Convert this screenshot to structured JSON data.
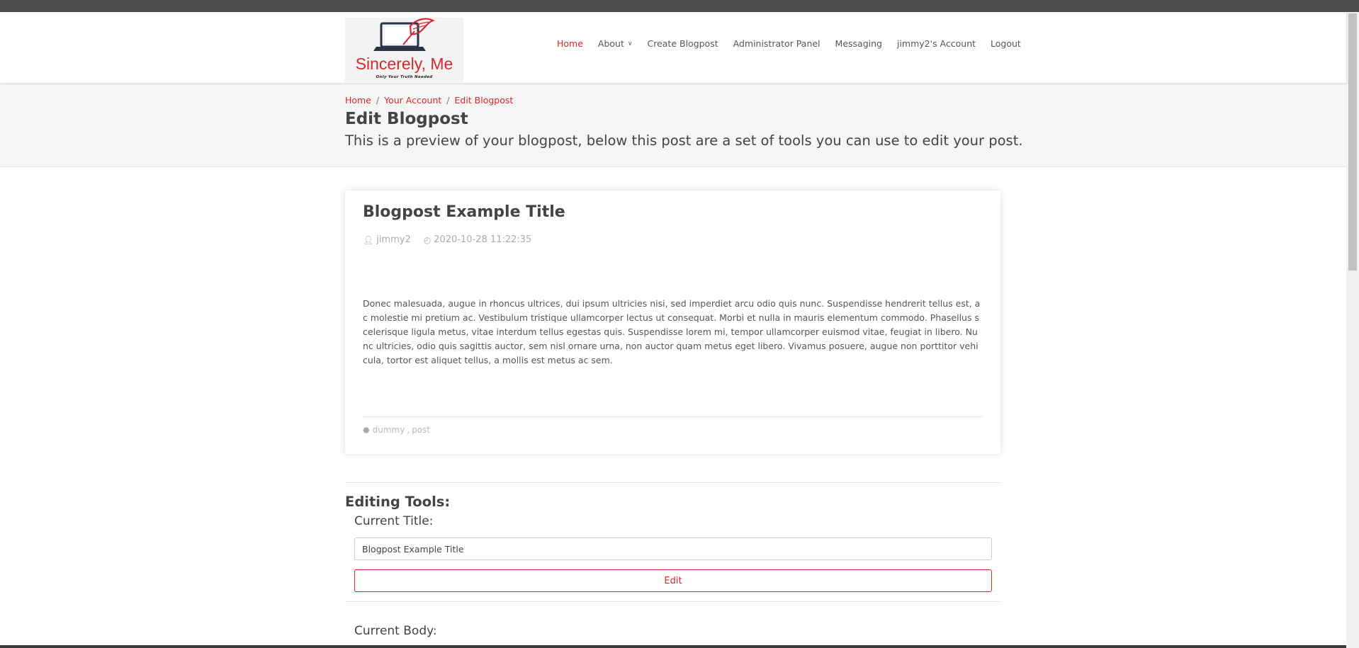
{
  "brand": {
    "name": "Sincerely, Me",
    "tagline": "Only Your Truth Needed",
    "accent_color": "#d7262d"
  },
  "nav": {
    "items": [
      {
        "label": "Home",
        "active": true
      },
      {
        "label": "About",
        "has_dropdown": true
      },
      {
        "label": "Create Blogpost"
      },
      {
        "label": "Administrator Panel"
      },
      {
        "label": "Messaging"
      },
      {
        "label": "jimmy2's Account"
      },
      {
        "label": "Logout"
      }
    ]
  },
  "breadcrumb": {
    "items": [
      "Home",
      "Your Account",
      "Edit Blogpost"
    ],
    "separator": "/"
  },
  "page": {
    "title": "Edit Blogpost",
    "subtitle": "This is a preview of your blogpost, below this post are a set of tools you can use to edit your post."
  },
  "post": {
    "title": "Blogpost Example Title",
    "author": "jimmy2",
    "author_icon": "user-icon",
    "date": "2020-10-28 11:22:35",
    "date_icon": "clock-icon",
    "body": "Donec malesuada, augue in rhoncus ultrices, dui ipsum ultricies nisi, sed imperdiet arcu odio quis nunc. Suspendisse hendrerit tellus est, ac molestie mi pretium ac. Vestibulum tristique ullamcorper lectus ut consequat. Morbi et nulla in mauris elementum commodo. Phasellus scelerisque ligula metus, vitae interdum tellus egestas quis. Suspendisse lorem mi, tempor ullamcorper euismod vitae, feugiat in libero. Nunc ultricies, odio quis sagittis auctor, sem nisl ornare urna, non auctor quam metus eget libero. Vivamus posuere, augue non porttitor vehicula, tortor est aliquet tellus, a mollis est metus ac sem.",
    "tags_icon": "tag-icon",
    "tags": [
      "dummy",
      "post"
    ],
    "tag_separator": ","
  },
  "tools": {
    "heading": "Editing Tools:",
    "title_label": "Current Title:",
    "title_value": "Blogpost Example Title",
    "edit_label": "Edit",
    "body_label": "Current Body:"
  }
}
